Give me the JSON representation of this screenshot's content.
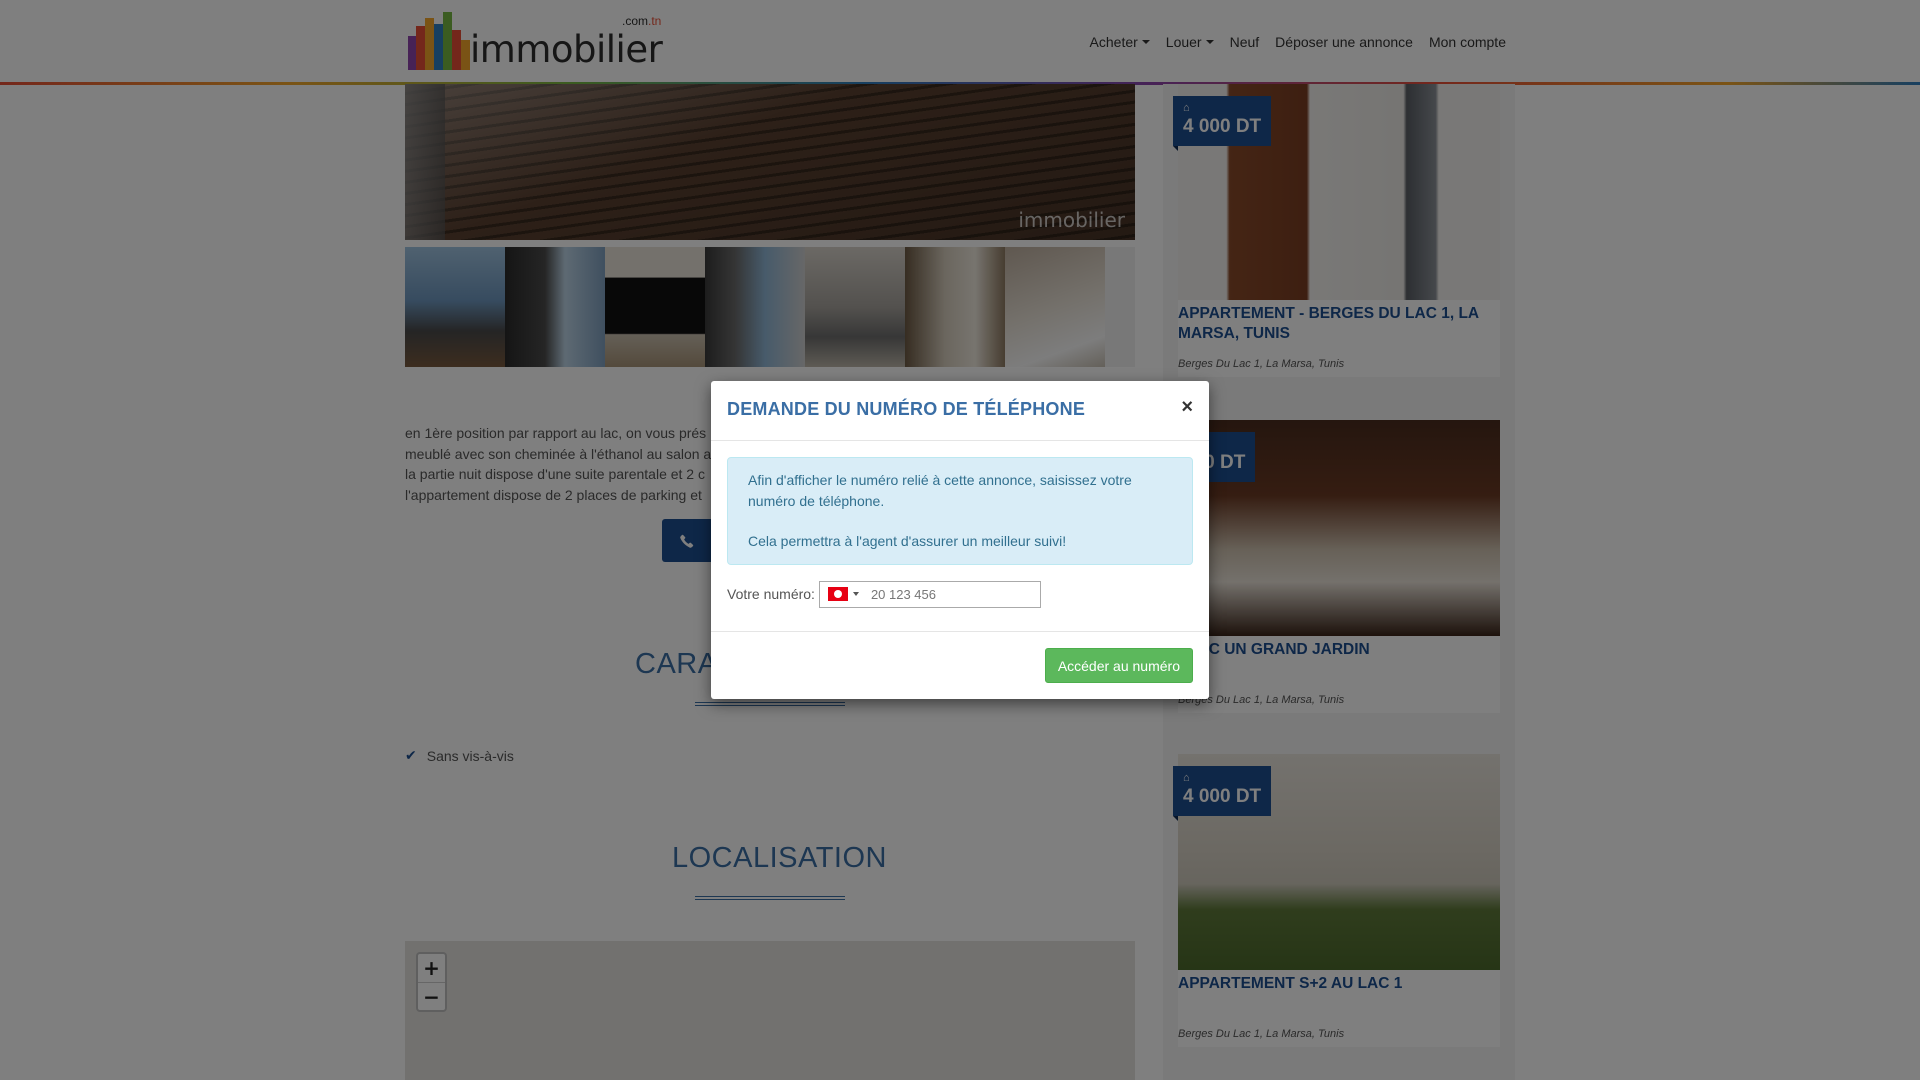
{
  "site": {
    "logo_text": "immobilier",
    "logo_tld_prefix": ".com",
    "logo_tld_suffix": ".tn"
  },
  "nav": {
    "items": [
      {
        "label": "Acheter",
        "dropdown": true
      },
      {
        "label": "Louer",
        "dropdown": true
      },
      {
        "label": "Neuf",
        "dropdown": false
      },
      {
        "label": "Déposer une annonce",
        "dropdown": false
      },
      {
        "label": "Mon compte",
        "dropdown": false
      }
    ]
  },
  "listing": {
    "watermark": "immobilier",
    "description_lines": [
      "en 1ère position par rapport au lac, on vous prés",
      "meublé avec son cheminée à l'éthanol au salon a",
      "la partie nuit dispose d'une suite parentale et 2 c",
      "l'appartement dispose de 2 places de parking et"
    ],
    "call_icon": "phone-icon",
    "features_title": "CARA",
    "features": [
      "Sans vis-à-vis"
    ],
    "localisation_title": "LOCALISATION",
    "map": {
      "zoom_in": "+",
      "zoom_out": "−"
    }
  },
  "sidebar": {
    "cards": [
      {
        "price": "4 000 DT",
        "title": "APPARTEMENT - BERGES DU LAC 1, LA MARSA, TUNIS",
        "location": "Berges Du Lac 1, La Marsa, Tunis"
      },
      {
        "price": "500 DT",
        "title": "AVEC UN GRAND JARDIN",
        "location": "Berges Du Lac 1, La Marsa, Tunis"
      },
      {
        "price": "4 000 DT",
        "title": "APPARTEMENT S+2 AU LAC 1",
        "location": "Berges Du Lac 1, La Marsa, Tunis"
      }
    ]
  },
  "modal": {
    "title": "DEMANDE DU NUMÉRO DE TÉLÉPHONE",
    "close": "×",
    "info_line1": "Afin d'afficher le numéro relié à cette annonce, saisissez votre numéro de téléphone.",
    "info_line2": "Cela permettra à l'agent d'assurer un meilleur suivi!",
    "phone_label": "Votre numéro:",
    "phone_placeholder": "20 123 456",
    "phone_value": "",
    "submit_label": "Accéder au numéro"
  },
  "colors": {
    "primary": "#1d4f91",
    "title_blue": "#3a6ea5",
    "success": "#5cb85c",
    "info_bg": "#d9edf7",
    "info_text": "#31708f"
  }
}
